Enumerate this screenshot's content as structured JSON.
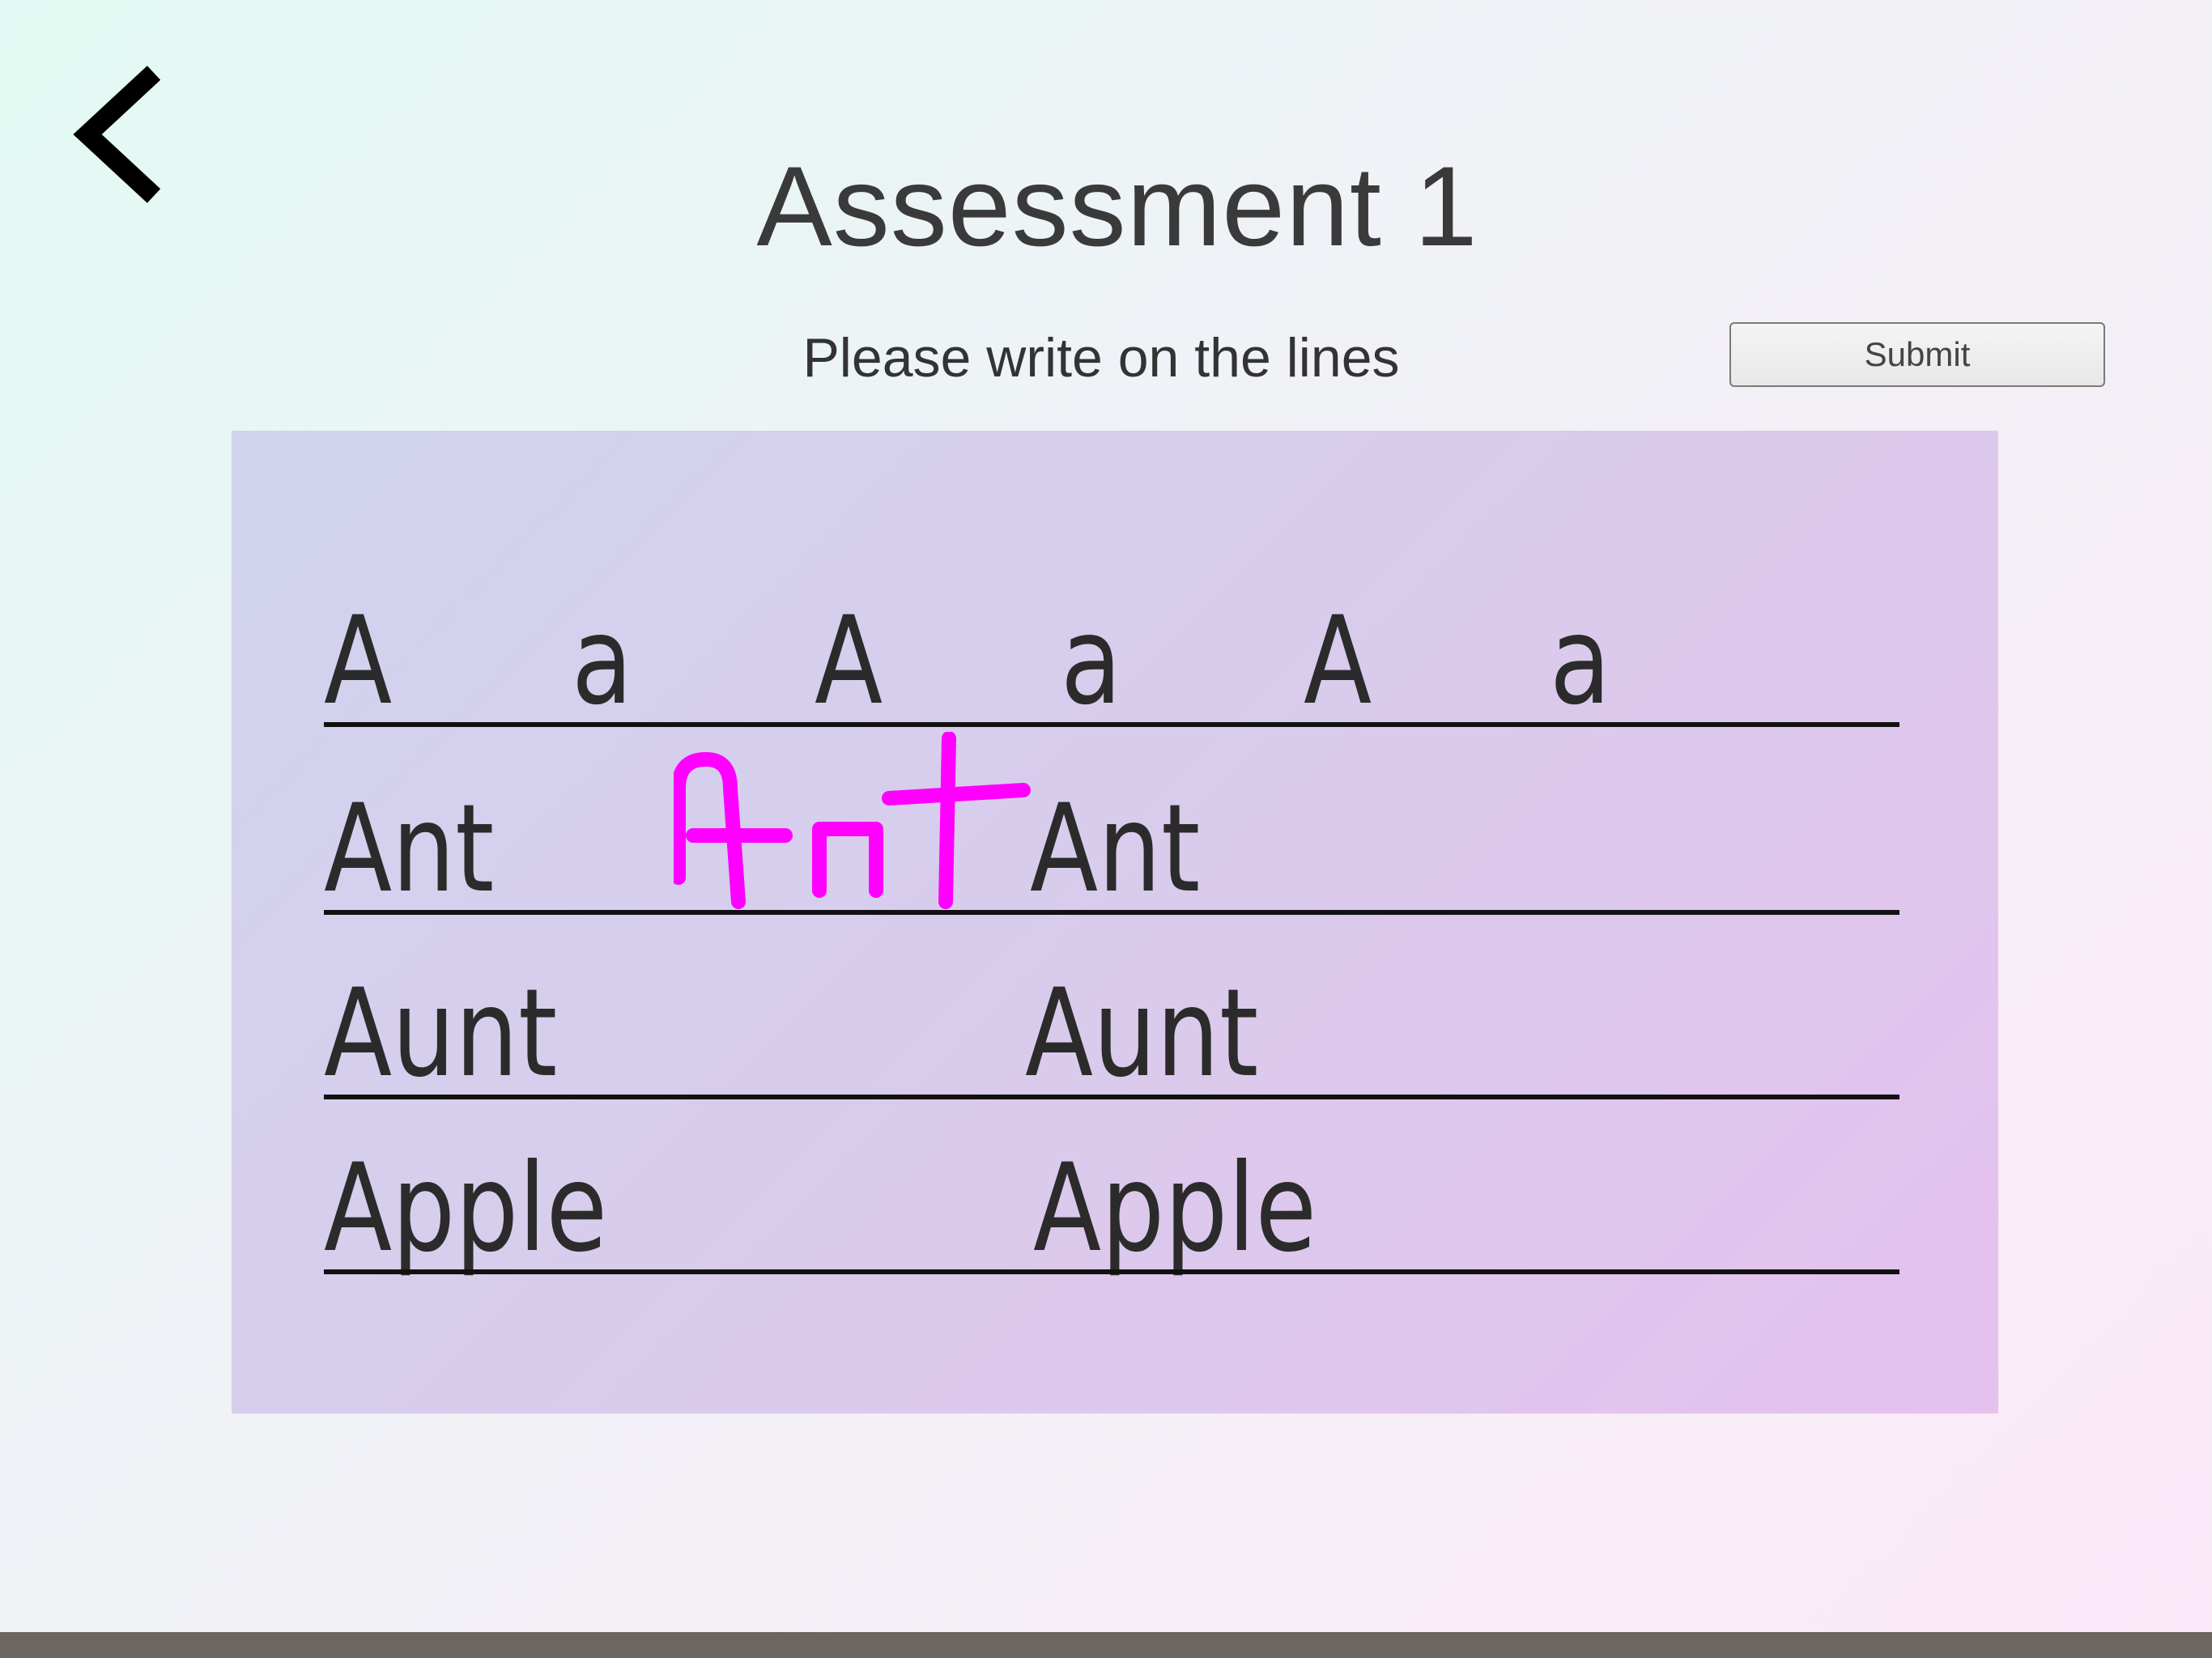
{
  "header": {
    "back_icon": "chevron-left-icon",
    "title": "Assessment 1"
  },
  "instruction": "Please write on the lines",
  "submit_label": "Submit",
  "worksheet": {
    "row1": [
      "A",
      "a",
      "A",
      "a",
      "A",
      "a"
    ],
    "row2": [
      "Ant",
      "Ant"
    ],
    "row3": [
      "Aunt",
      "Aunt"
    ],
    "row4": [
      "Apple",
      "Apple"
    ],
    "handwritten_text": "Ant",
    "handwriting_color": "#ff00ff",
    "rule_color": "#111111"
  }
}
